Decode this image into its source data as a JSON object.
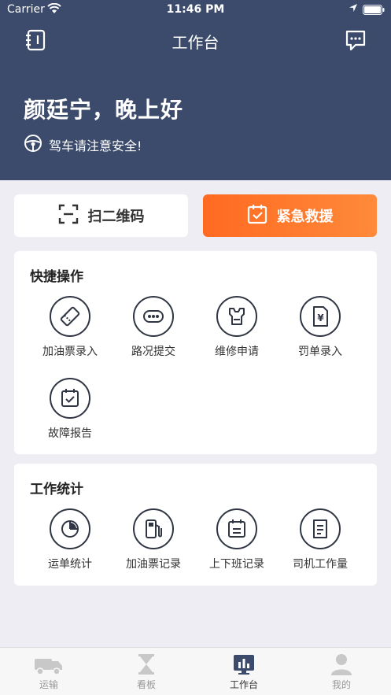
{
  "status_bar": {
    "carrier": "Carrier",
    "time": "11:46 PM"
  },
  "header": {
    "title": "工作台",
    "greeting": "颜廷宁，晚上好",
    "safety_tip": "驾车请注意安全!"
  },
  "actions": {
    "scan_label": "扫二维码",
    "rescue_label": "紧急救援"
  },
  "quick_ops": {
    "title": "快捷操作",
    "items": [
      {
        "label": "加油票录入",
        "icon": "fuel-ticket-icon"
      },
      {
        "label": "路况提交",
        "icon": "road-condition-icon"
      },
      {
        "label": "维修申请",
        "icon": "repair-icon"
      },
      {
        "label": "罚单录入",
        "icon": "fine-ticket-icon"
      },
      {
        "label": "故障报告",
        "icon": "fault-report-icon"
      }
    ]
  },
  "work_stats": {
    "title": "工作统计",
    "items": [
      {
        "label": "运单统计",
        "icon": "pie-chart-icon"
      },
      {
        "label": "加油票记录",
        "icon": "fuel-pump-icon"
      },
      {
        "label": "上下班记录",
        "icon": "calendar-icon"
      },
      {
        "label": "司机工作量",
        "icon": "document-icon"
      }
    ]
  },
  "tabbar": {
    "items": [
      {
        "label": "运输",
        "icon": "truck-icon"
      },
      {
        "label": "看板",
        "icon": "hourglass-icon"
      },
      {
        "label": "工作台",
        "icon": "dashboard-icon",
        "active": true
      },
      {
        "label": "我的",
        "icon": "user-icon"
      }
    ]
  },
  "colors": {
    "header_bg": "#3c4b6b",
    "accent": "#ff6a21",
    "page_bg": "#ededf3"
  }
}
